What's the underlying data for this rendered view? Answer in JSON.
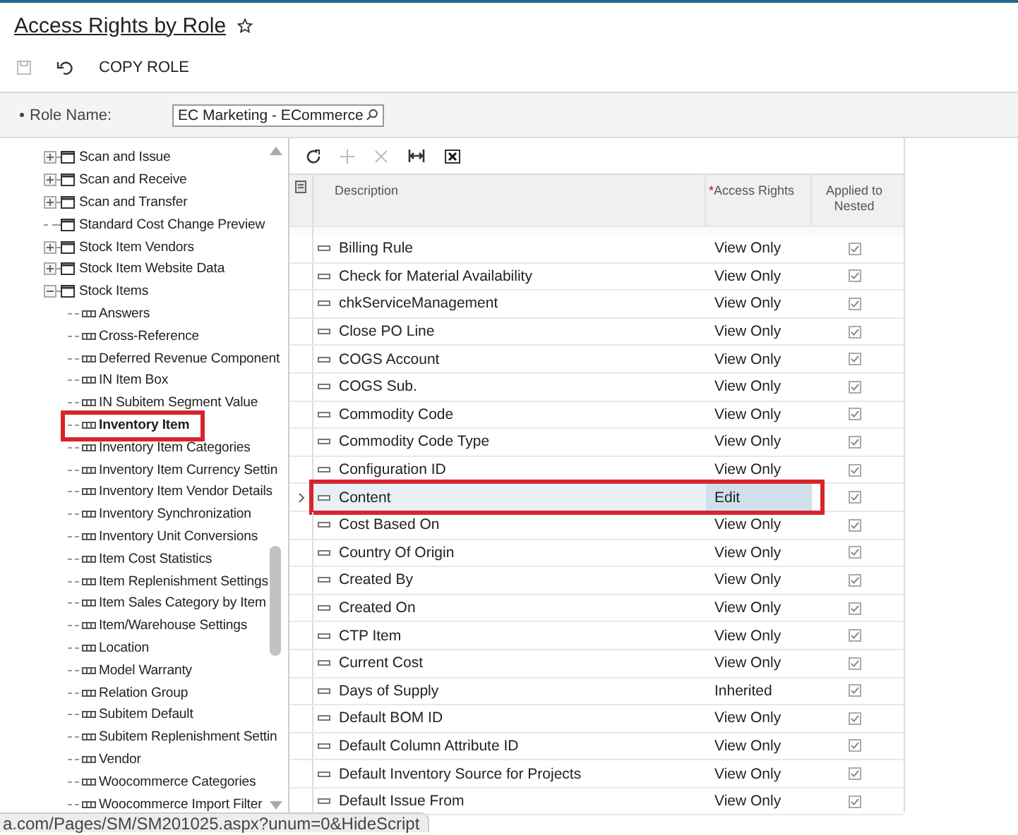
{
  "page": {
    "title": "Access Rights by Role",
    "favorite": false
  },
  "toolbar": {
    "save_disabled": true,
    "copy_role": "COPY ROLE"
  },
  "form": {
    "role_name_label": "Role Name:",
    "role_name_value": "EC Marketing - ECommerce"
  },
  "tree": [
    {
      "label": "Scan and Issue",
      "expanded": false,
      "selected": false
    },
    {
      "label": "Scan and Receive",
      "expanded": false,
      "selected": false
    },
    {
      "label": "Scan and Transfer",
      "expanded": false,
      "selected": false
    },
    {
      "label": "Standard Cost Change Preview",
      "selected": false
    },
    {
      "label": "Stock Item Vendors",
      "expanded": false,
      "selected": false
    },
    {
      "label": "Stock Item Website Data",
      "expanded": false,
      "selected": false
    },
    {
      "label": "Stock Items",
      "expanded": true,
      "selected": false,
      "children": [
        {
          "label": "Answers",
          "selected": false
        },
        {
          "label": "Cross-Reference",
          "selected": false
        },
        {
          "label": "Deferred Revenue Component",
          "selected": false
        },
        {
          "label": "IN Item Box",
          "selected": false
        },
        {
          "label": "IN Subitem Segment Value",
          "selected": false
        },
        {
          "label": "Inventory Item",
          "selected": true
        },
        {
          "label": "Inventory Item Categories",
          "selected": false
        },
        {
          "label": "Inventory Item Currency Settin",
          "selected": false
        },
        {
          "label": "Inventory Item Vendor Details",
          "selected": false
        },
        {
          "label": "Inventory Synchronization",
          "selected": false
        },
        {
          "label": "Inventory Unit Conversions",
          "selected": false
        },
        {
          "label": "Item Cost Statistics",
          "selected": false
        },
        {
          "label": "Item Replenishment Settings",
          "selected": false
        },
        {
          "label": "Item Sales Category by Item",
          "selected": false
        },
        {
          "label": "Item/Warehouse Settings",
          "selected": false
        },
        {
          "label": "Location",
          "selected": false
        },
        {
          "label": "Model Warranty",
          "selected": false
        },
        {
          "label": "Relation Group",
          "selected": false
        },
        {
          "label": "Subitem Default",
          "selected": false
        },
        {
          "label": "Subitem Replenishment Settin",
          "selected": false
        },
        {
          "label": "Vendor",
          "selected": false
        },
        {
          "label": "Woocommerce Categories",
          "selected": false
        },
        {
          "label": "Woocommerce Import Filter",
          "selected": false
        }
      ]
    }
  ],
  "grid": {
    "columns": [
      {
        "label": "Description"
      },
      {
        "label": "Access Rights",
        "required": true,
        "required_mark": "*"
      },
      {
        "label": "Applied to Nested"
      }
    ],
    "rows": [
      {
        "description": "Billing Rule",
        "access": "View Only",
        "applied": true,
        "selected": false
      },
      {
        "description": "Check for Material Availability",
        "access": "View Only",
        "applied": true,
        "selected": false
      },
      {
        "description": "chkServiceManagement",
        "access": "View Only",
        "applied": true,
        "selected": false
      },
      {
        "description": "Close PO Line",
        "access": "View Only",
        "applied": true,
        "selected": false
      },
      {
        "description": "COGS Account",
        "access": "View Only",
        "applied": true,
        "selected": false
      },
      {
        "description": "COGS Sub.",
        "access": "View Only",
        "applied": true,
        "selected": false
      },
      {
        "description": "Commodity Code",
        "access": "View Only",
        "applied": true,
        "selected": false
      },
      {
        "description": "Commodity Code Type",
        "access": "View Only",
        "applied": true,
        "selected": false
      },
      {
        "description": "Configuration ID",
        "access": "View Only",
        "applied": true,
        "selected": false
      },
      {
        "description": "Content",
        "access": "Edit",
        "applied": true,
        "selected": true
      },
      {
        "description": "Cost Based On",
        "access": "View Only",
        "applied": true,
        "selected": false
      },
      {
        "description": "Country Of Origin",
        "access": "View Only",
        "applied": true,
        "selected": false
      },
      {
        "description": "Created By",
        "access": "View Only",
        "applied": true,
        "selected": false
      },
      {
        "description": "Created On",
        "access": "View Only",
        "applied": true,
        "selected": false
      },
      {
        "description": "CTP Item",
        "access": "View Only",
        "applied": true,
        "selected": false
      },
      {
        "description": "Current Cost",
        "access": "View Only",
        "applied": true,
        "selected": false
      },
      {
        "description": "Days of Supply",
        "access": "Inherited",
        "applied": true,
        "selected": false
      },
      {
        "description": "Default BOM ID",
        "access": "View Only",
        "applied": true,
        "selected": false
      },
      {
        "description": "Default Column Attribute ID",
        "access": "View Only",
        "applied": true,
        "selected": false
      },
      {
        "description": "Default Inventory Source for Projects",
        "access": "View Only",
        "applied": true,
        "selected": false
      },
      {
        "description": "Default Issue From",
        "access": "View Only",
        "applied": true,
        "selected": false
      }
    ]
  },
  "status_bar": {
    "url": "a.com/Pages/SM/SM201025.aspx?unum=0&HideScript"
  }
}
